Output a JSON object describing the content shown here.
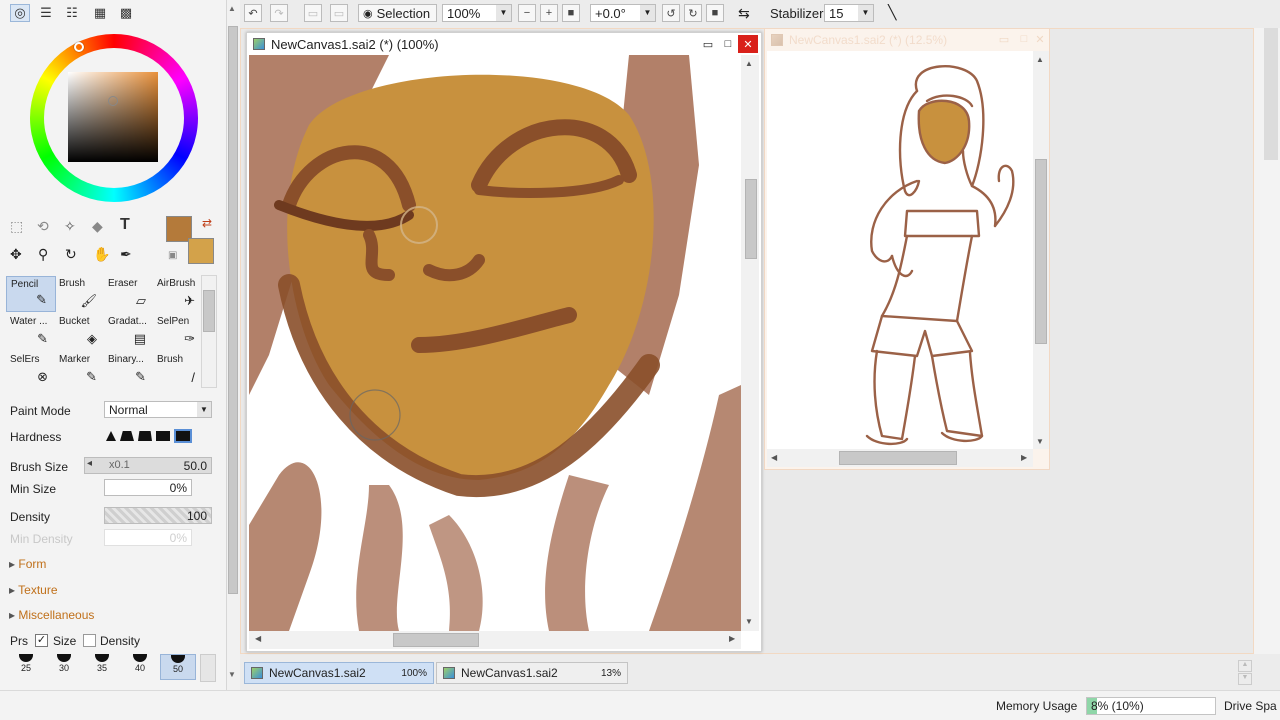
{
  "toolbar": {
    "selection_label": "Selection",
    "zoom_value": "100%",
    "rotation_value": "+0.0°",
    "stabilizer_label": "Stabilizer",
    "stabilizer_value": "15"
  },
  "tools": [
    {
      "label": "Pencil",
      "glyph": "✎"
    },
    {
      "label": "Brush",
      "glyph": "🖌"
    },
    {
      "label": "Eraser",
      "glyph": "▱"
    },
    {
      "label": "AirBrush",
      "glyph": "✈"
    },
    {
      "label": "Water ...",
      "glyph": "✎"
    },
    {
      "label": "Bucket",
      "glyph": "◈"
    },
    {
      "label": "Gradat...",
      "glyph": "▤"
    },
    {
      "label": "SelPen",
      "glyph": "✑"
    },
    {
      "label": "SelErs",
      "glyph": "⊗"
    },
    {
      "label": "Marker",
      "glyph": "✎"
    },
    {
      "label": "Binary...",
      "glyph": "✎"
    },
    {
      "label": "Brush",
      "glyph": "/"
    }
  ],
  "properties": {
    "paint_mode_label": "Paint Mode",
    "paint_mode_value": "Normal",
    "hardness_label": "Hardness",
    "brush_size_label": "Brush Size",
    "brush_size_mult": "x0.1",
    "brush_size_value": "50.0",
    "min_size_label": "Min Size",
    "min_size_value": "0%",
    "density_label": "Density",
    "density_value": "100",
    "min_density_label": "Min Density",
    "min_density_value": "0%",
    "sections": [
      "Form",
      "Texture",
      "Miscellaneous"
    ],
    "prs_label": "Prs",
    "size_label": "Size",
    "density_chk_label": "Density",
    "size_presets": [
      "25",
      "30",
      "35",
      "40",
      "50"
    ]
  },
  "canvas_main": {
    "title": "NewCanvas1.sai2 (*) (100%)"
  },
  "canvas_second": {
    "title": "NewCanvas1.sai2 (*) (12.5%)"
  },
  "tabs": [
    {
      "name": "NewCanvas1.sai2",
      "pct": "100%"
    },
    {
      "name": "NewCanvas1.sai2",
      "pct": "13%"
    }
  ],
  "status": {
    "memory_label": "Memory Usage",
    "memory_value": "8% (10%)",
    "memory_fraction": 0.08,
    "drive_label": "Drive Spa"
  },
  "colors": {
    "primary": "#b47a3a",
    "secondary": "#d3a24a",
    "skin": "#c8913e",
    "stroke": "#9b6147",
    "close_red": "#d9201a"
  }
}
